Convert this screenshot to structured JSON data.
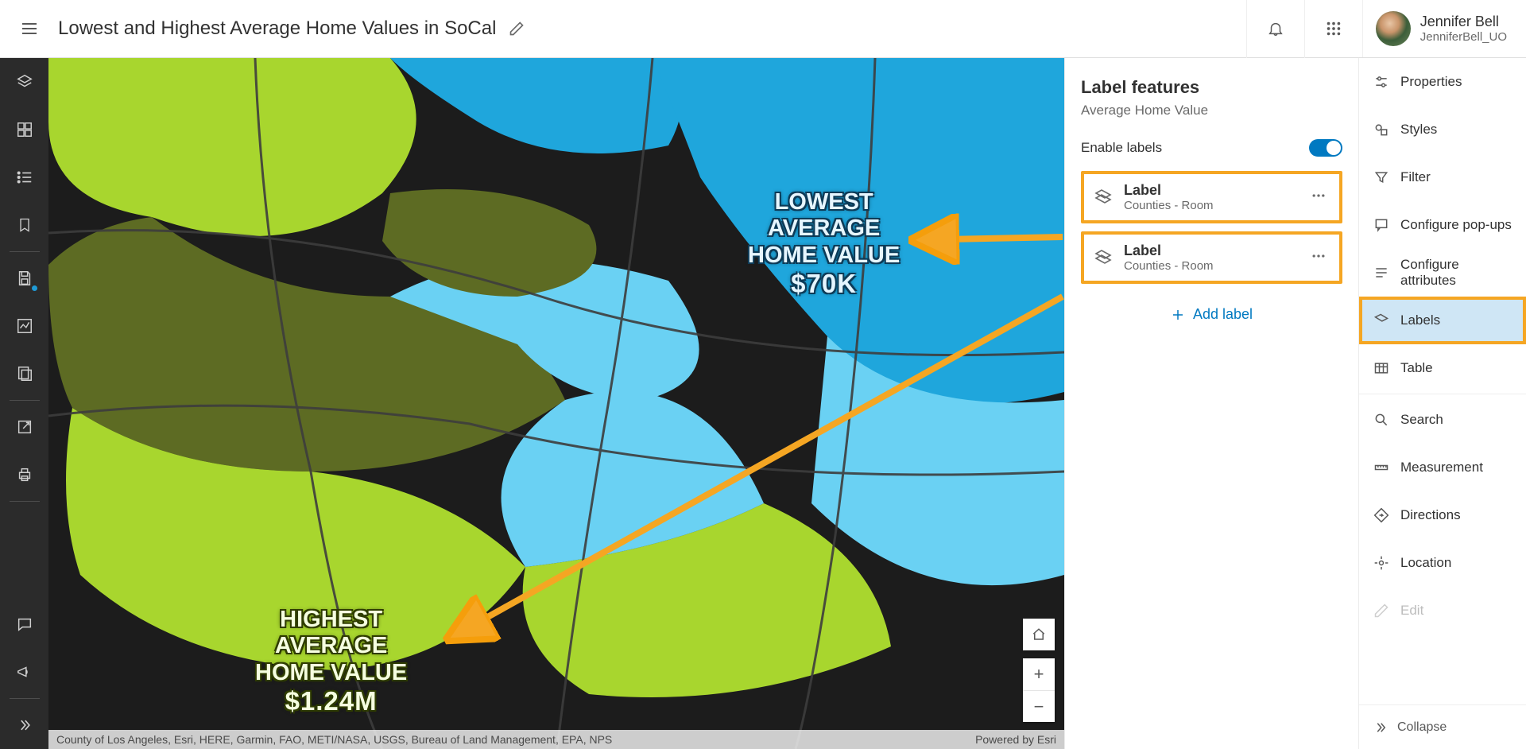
{
  "header": {
    "title": "Lowest and Highest Average Home Values in SoCal",
    "user_name": "Jennifer Bell",
    "user_handle": "JenniferBell_UO"
  },
  "map": {
    "label_low_line1": "Lowest",
    "label_low_line2": "Average",
    "label_low_line3": "Home Value",
    "label_low_amount": "$70K",
    "label_high_line1": "Highest",
    "label_high_line2": "Average",
    "label_high_line3": "Home Value",
    "label_high_amount": "$1.24M",
    "attribution_left": "County of Los Angeles, Esri, HERE, Garmin, FAO, METI/NASA, USGS, Bureau of Land Management, EPA, NPS",
    "attribution_right": "Powered by Esri"
  },
  "side_panel": {
    "title": "Label features",
    "subtitle": "Average Home Value",
    "enable_labels": "Enable labels",
    "add_label": "Add label",
    "cards": [
      {
        "title": "Label",
        "subtitle": "Counties - Room"
      },
      {
        "title": "Label",
        "subtitle": "Counties - Room"
      }
    ]
  },
  "right_rail": {
    "properties": "Properties",
    "styles": "Styles",
    "filter": "Filter",
    "popups": "Configure pop-ups",
    "attributes": "Configure attributes",
    "labels": "Labels",
    "table": "Table",
    "search": "Search",
    "measurement": "Measurement",
    "directions": "Directions",
    "location": "Location",
    "edit": "Edit",
    "collapse": "Collapse"
  },
  "colors": {
    "accent": "#0079c1",
    "annotation": "#f5a623",
    "map_green": "#a8d62e",
    "map_olive": "#5d6b23",
    "map_cyan_light": "#6ad1f3",
    "map_cyan": "#1fa6dc",
    "map_dark": "#1c1c1c"
  }
}
